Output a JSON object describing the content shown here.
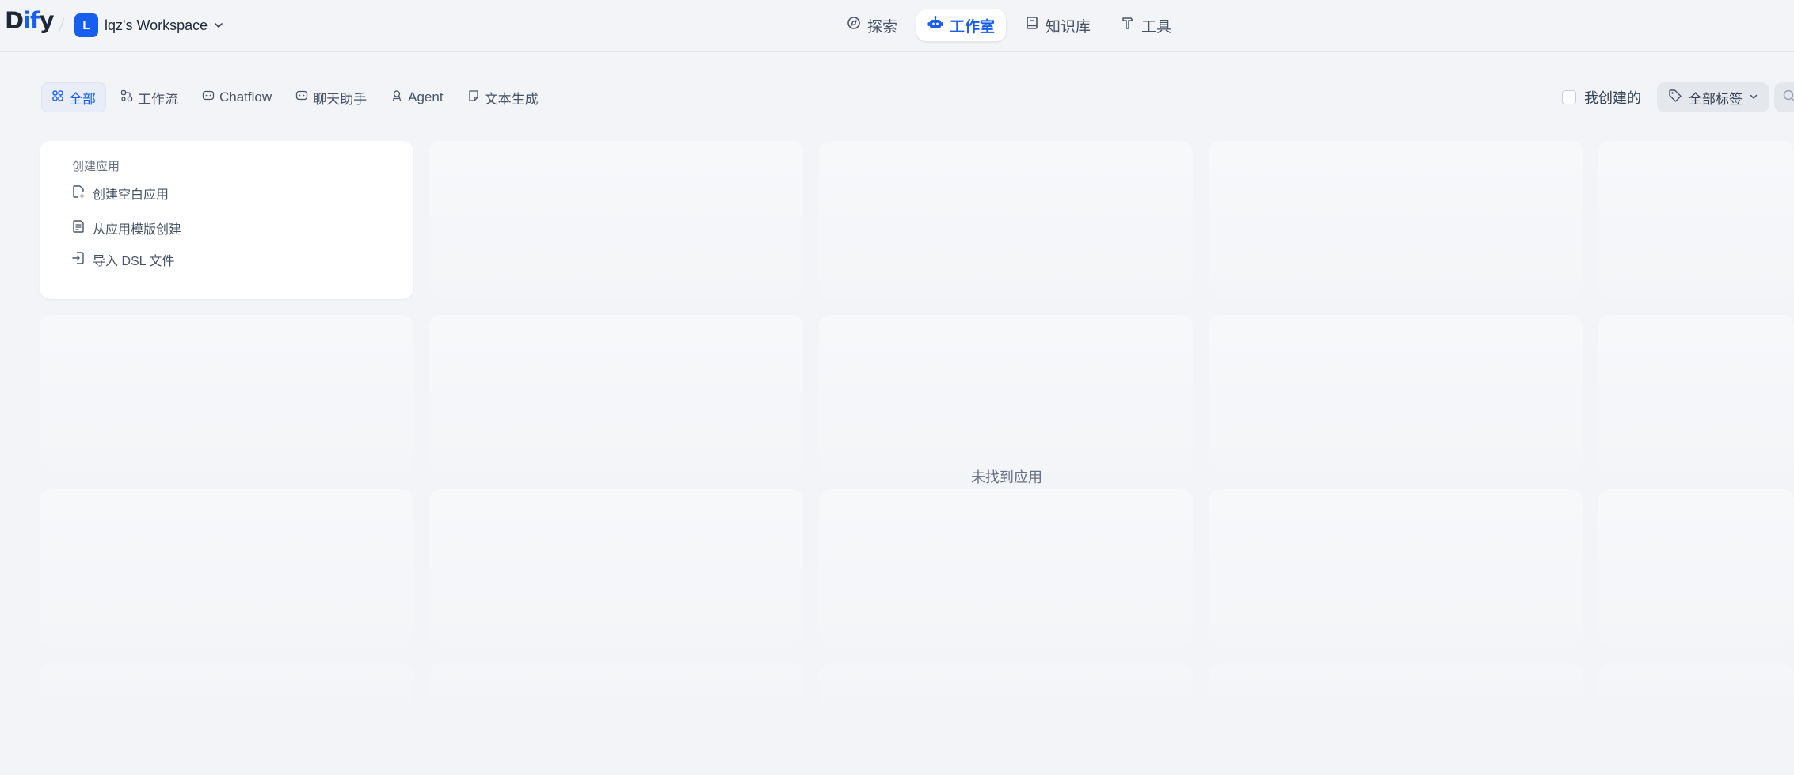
{
  "header": {
    "logo": {
      "part1": "D",
      "accent": "if",
      "part2": "y"
    },
    "workspace": {
      "avatar_letter": "L",
      "name": "lqz's Workspace"
    },
    "nav": [
      {
        "label": "探索",
        "icon": "compass-icon",
        "active": false
      },
      {
        "label": "工作室",
        "icon": "robot-icon",
        "active": true
      },
      {
        "label": "知识库",
        "icon": "book-icon",
        "active": false
      },
      {
        "label": "工具",
        "icon": "hammer-icon",
        "active": false
      }
    ]
  },
  "filters": {
    "tabs": [
      {
        "label": "全部",
        "icon": "grid-icon",
        "active": true
      },
      {
        "label": "工作流",
        "icon": "workflow-icon",
        "active": false
      },
      {
        "label": "Chatflow",
        "icon": "chatflow-icon",
        "active": false
      },
      {
        "label": "聊天助手",
        "icon": "chat-bubble-icon",
        "active": false
      },
      {
        "label": "Agent",
        "icon": "agent-icon",
        "active": false
      },
      {
        "label": "文本生成",
        "icon": "note-icon",
        "active": false
      }
    ],
    "created_by_me": {
      "label": "我创建的",
      "checked": false
    },
    "tag_filter": {
      "label": "全部标签"
    }
  },
  "create_card": {
    "title": "创建应用",
    "options": [
      {
        "label": "创建空白应用",
        "icon": "file-plus-icon"
      },
      {
        "label": "从应用模版创建",
        "icon": "template-icon"
      },
      {
        "label": "导入 DSL 文件",
        "icon": "file-import-icon"
      }
    ]
  },
  "empty_state": "未找到应用",
  "colors": {
    "accent": "#155eef",
    "background": "#f2f4f7",
    "card": "#ffffff",
    "text": "#354052"
  }
}
